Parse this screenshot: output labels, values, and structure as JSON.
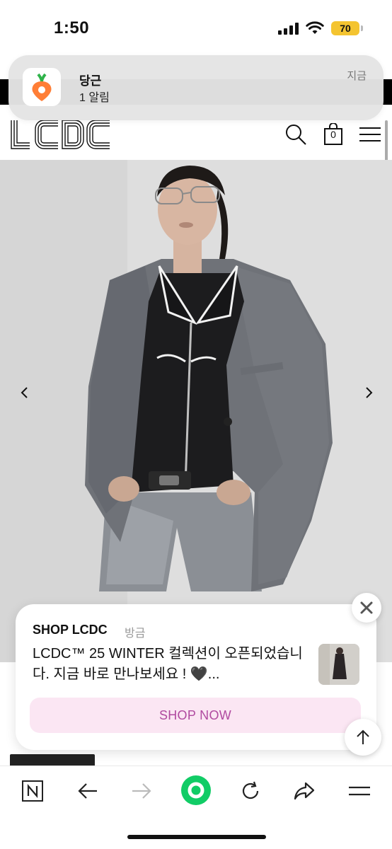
{
  "status_bar": {
    "time": "1:50",
    "battery": "70",
    "battery_color": "#f4c430"
  },
  "notification": {
    "app_name": "당근",
    "body": "1 알림",
    "time": "지금",
    "icon": "carrot-app-icon"
  },
  "site": {
    "logo": "LCDC",
    "cart_count": "0",
    "icons": [
      "search-icon",
      "shopping-bag-icon",
      "hamburger-menu-icon"
    ]
  },
  "hero": {
    "prev_icon": "chevron-left-icon",
    "next_icon": "chevron-right-icon"
  },
  "popup": {
    "source": "SHOP LCDC",
    "time": "방금",
    "message": "LCDC™ 25 WINTER 컬렉션이 오픈되었습니다. 지금 바로 만나보세요 ! 🖤...",
    "cta": "SHOP NOW",
    "cta_color": "#fbe6f3"
  },
  "toolbar": {
    "items": [
      "naver-home-icon",
      "back-arrow-icon",
      "forward-arrow-icon",
      "green-dot-icon",
      "reload-icon",
      "share-icon",
      "menu-icon"
    ],
    "accent": "#11cc66"
  }
}
